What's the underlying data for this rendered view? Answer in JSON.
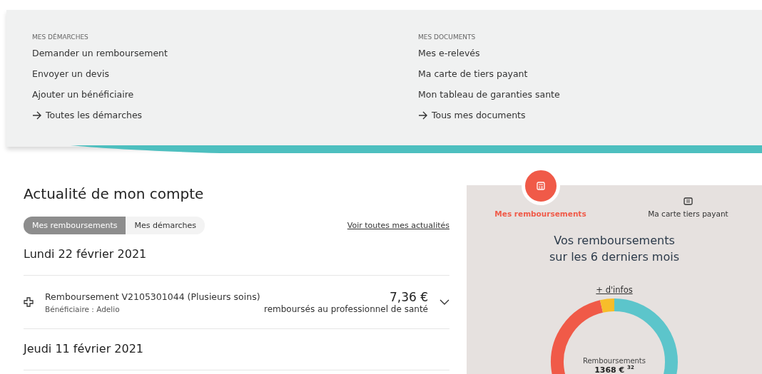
{
  "menu": {
    "columns": [
      {
        "heading": "MES DÉMARCHES",
        "links": [
          {
            "label": "Demander un remboursement",
            "kind": "plain"
          },
          {
            "label": "Envoyer un devis",
            "kind": "plain"
          },
          {
            "label": "Ajouter un bénéficiaire",
            "kind": "plain"
          },
          {
            "label": "Toutes les démarches",
            "kind": "more"
          }
        ]
      },
      {
        "heading": "MES DOCUMENTS",
        "links": [
          {
            "label": "Mes e-relevés",
            "kind": "plain"
          },
          {
            "label": "Ma carte de tiers payant",
            "kind": "plain"
          },
          {
            "label": "Mon tableau de garanties sante",
            "kind": "plain"
          },
          {
            "label": "Tous mes documents",
            "kind": "more"
          }
        ]
      }
    ]
  },
  "news": {
    "title": "Actualité de mon compte",
    "tabs": [
      {
        "label": "Mes remboursements",
        "selected": true
      },
      {
        "label": "Mes démarches",
        "selected": false
      }
    ],
    "see_all": "Voir toutes mes actualités",
    "days": [
      {
        "date": "Lundi 22 février 2021",
        "items": [
          {
            "title": "Remboursement V2105301044 (Plusieurs soins)",
            "beneficiary": "Bénéficiaire : Adelio",
            "amount": "7,36 €",
            "note": "remboursés au professionnel de santé",
            "expanded": false
          }
        ]
      },
      {
        "date": "Jeudi 11 février 2021"
      }
    ]
  },
  "summary": {
    "tabs": [
      {
        "label": "Mes remboursements",
        "selected": true,
        "kind": "calculator"
      },
      {
        "label": "Ma carte tiers payant",
        "selected": false,
        "kind": "card"
      }
    ],
    "title": "Vos remboursements\nsur les 6 derniers mois",
    "info_link": "+ d'infos",
    "total_label": "Remboursements",
    "total": "1368 €",
    "total_cents": "32"
  }
}
